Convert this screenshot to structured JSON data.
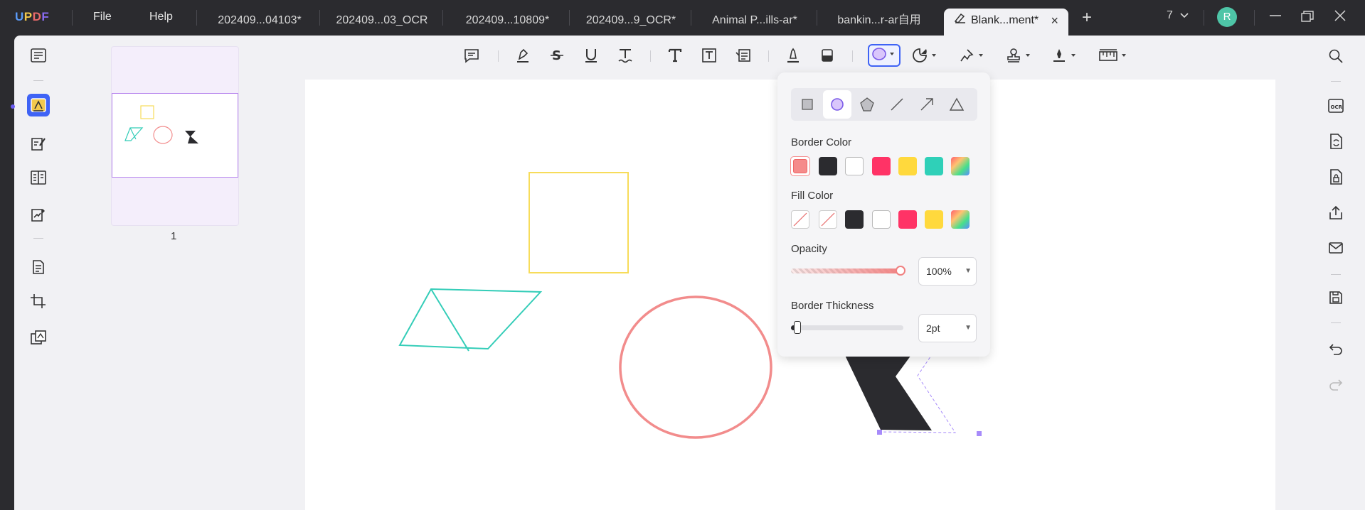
{
  "app": {
    "logo": {
      "u": "U",
      "p": "P",
      "d": "D",
      "f": "F"
    },
    "menu": [
      "File",
      "Help"
    ]
  },
  "tabs": [
    {
      "label": "202409...04103*"
    },
    {
      "label": "202409...03_OCR"
    },
    {
      "label": "202409...10809*"
    },
    {
      "label": "202409...9_OCR*"
    },
    {
      "label": "Animal P...ills-ar*"
    },
    {
      "label": "bankin...r-ar自用"
    },
    {
      "label": "Blank...ment*",
      "active": true
    }
  ],
  "titlebar": {
    "page_count": "7",
    "avatar_letter": "R"
  },
  "left_tools": [
    "reader-icon",
    "comment-icon",
    "edit-icon",
    "form-icon",
    "sign-icon",
    "organize-icon",
    "crop-icon",
    "layers-icon"
  ],
  "thumbnail": {
    "page_number": "1"
  },
  "toolbar": {
    "tools": [
      "note-icon",
      "highlight-icon",
      "strikethrough-icon",
      "underline-icon",
      "squiggly-icon",
      "text-icon",
      "textbox-icon",
      "callout-icon",
      "pencil-icon",
      "eraser-icon",
      "shape-icon",
      "sticker-icon",
      "pin-icon",
      "stamp-icon",
      "signature-icon",
      "measure-icon"
    ]
  },
  "shape_popover": {
    "shapes": [
      "rectangle",
      "ellipse",
      "polygon",
      "line",
      "arrow",
      "triangle"
    ],
    "selected_shape": "ellipse",
    "border_color_label": "Border Color",
    "border_colors": [
      "#f58b8b",
      "#2b2b2f",
      "#ffffff",
      "#ff3366",
      "#ffd93d",
      "#2fd0b8",
      "gradient"
    ],
    "fill_color_label": "Fill Color",
    "fill_colors": [
      "none",
      "none",
      "#2b2b2f",
      "#ffffff",
      "#ff3366",
      "#ffd93d",
      "gradient"
    ],
    "opacity_label": "Opacity",
    "opacity_value": "100%",
    "thickness_label": "Border Thickness",
    "thickness_value": "2pt"
  },
  "colors": {
    "accent": "#3f63f5",
    "square": "#f7dc5a",
    "triangle": "#34cdb8",
    "circle": "#f28c8c",
    "hourglass": "#2b2b2f",
    "selection": "#a78bfa"
  }
}
